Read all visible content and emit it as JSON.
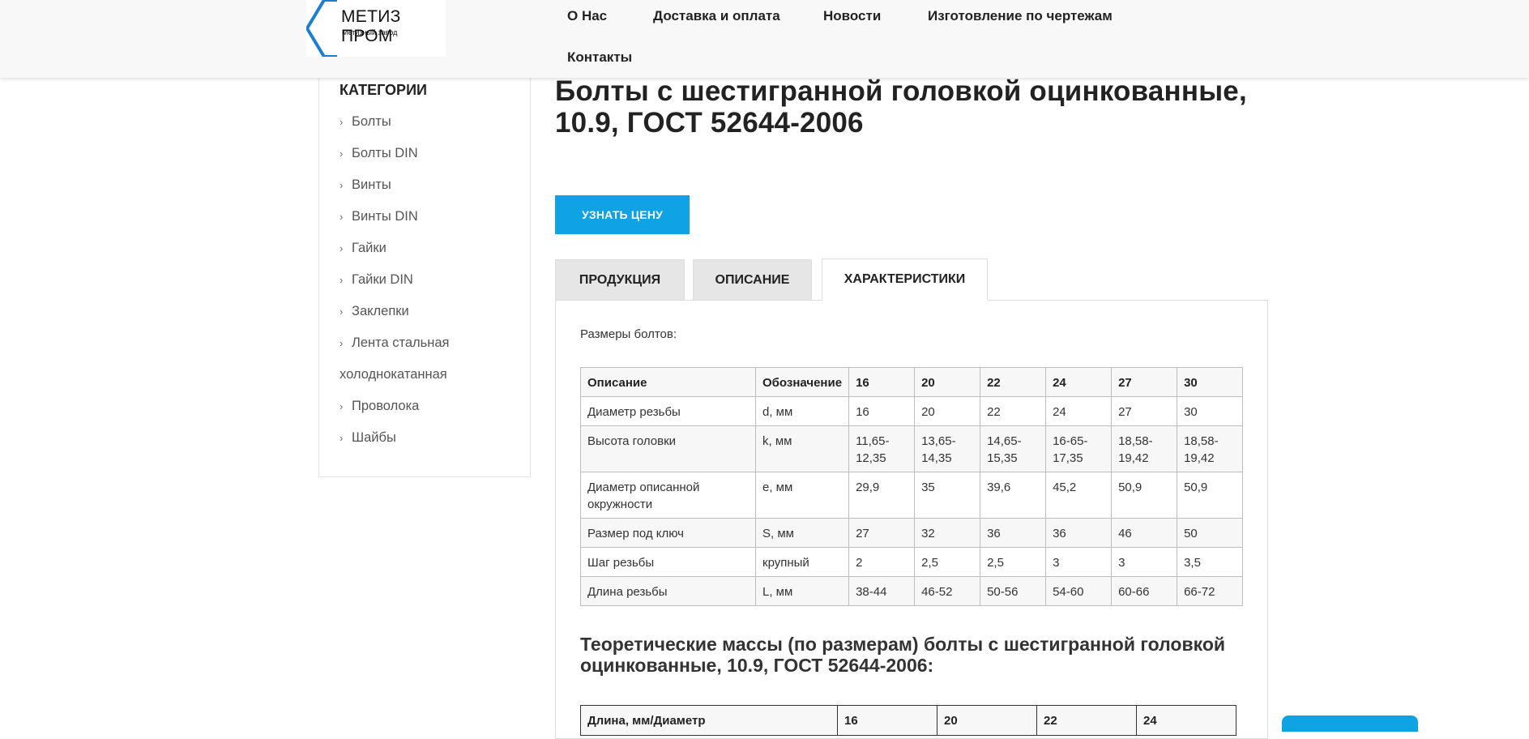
{
  "header": {
    "logo_title": "МЕТИЗ ПРОМ",
    "logo_subtitle": "Метизный завод",
    "nav": [
      "О Нас",
      "Доставка и оплата",
      "Новости",
      "Изготовление по чертежам",
      "Контакты"
    ]
  },
  "sidebar": {
    "title": "КАТЕГОРИИ",
    "items": [
      "Болты",
      "Болты DIN",
      "Винты",
      "Винты DIN",
      "Гайки",
      "Гайки DIN",
      "Заклепки",
      "Лента стальная",
      "Проволока",
      "Шайбы"
    ],
    "wrapped_line": "холоднокатанная"
  },
  "main": {
    "title_line1": "Болты с шестигранной головкой оцинкованные,",
    "title_line2": "10.9, ГОСТ 52644-2006",
    "price_button": "УЗНАТЬ ЦЕНУ",
    "tabs": [
      "ПРОДУКЦИЯ",
      "ОПИСАНИЕ",
      "ХАРАКТЕРИСТИКИ"
    ],
    "active_tab": "ХАРАКТЕРИСТИКИ",
    "intro": "Размеры болтов:",
    "spec_table": {
      "headers": [
        "Описание",
        "Обозначение",
        "16",
        "20",
        "22",
        "24",
        "27",
        "30"
      ],
      "rows": [
        [
          "Диаметр резьбы",
          "d, мм",
          "16",
          "20",
          "22",
          "24",
          "27",
          "30"
        ],
        [
          "Высота головки",
          "k, мм",
          "11,65-12,35",
          "13,65-14,35",
          "14,65-15,35",
          "16-65-17,35",
          "18,58-19,42",
          "18,58-19,42"
        ],
        [
          "Диаметр описанной окружности",
          "e, мм",
          "29,9",
          "35",
          "39,6",
          "45,2",
          "50,9",
          "50,9"
        ],
        [
          "Размер под ключ",
          "S, мм",
          "27",
          "32",
          "36",
          "36",
          "46",
          "50"
        ],
        [
          "Шаг резьбы",
          "крупный",
          "2",
          "2,5",
          "2,5",
          "3",
          "3",
          "3,5"
        ],
        [
          "Длина резьбы",
          "L, мм",
          "38-44",
          "46-52",
          "50-56",
          "54-60",
          "60-66",
          "66-72"
        ]
      ]
    },
    "subheading": "Теоретические массы (по размерам) болты с шестигранной головкой оцинкованные, 10.9, ГОСТ 52644-2006:",
    "mass_table_headers": [
      "Длина, мм/Диаметр",
      "16",
      "20",
      "22",
      "24"
    ]
  },
  "colors": {
    "accent": "#0fa2e5",
    "logo_hex": "#1a7fd0"
  }
}
